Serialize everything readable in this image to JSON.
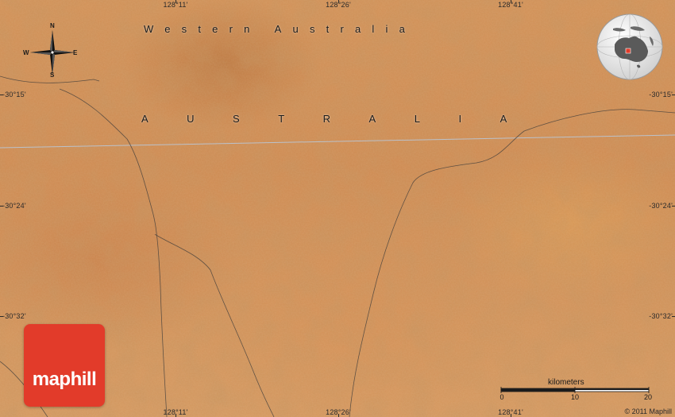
{
  "map": {
    "region_label": "Western Australia",
    "country_label": "AUSTRALIA",
    "coordinates": {
      "longitudes": [
        "128°11'",
        "128°26'",
        "128°41'"
      ],
      "latitudes": [
        "-30°15'",
        "-30°24'",
        "-30°32'"
      ]
    },
    "compass": {
      "north": "N",
      "south": "S",
      "east": "E",
      "west": "W"
    },
    "scale": {
      "unit_label": "kilometers",
      "values": [
        "0",
        "10",
        "20"
      ]
    },
    "logo_text": "maphill",
    "copyright": "© 2011 Maphill",
    "icons": [
      "compass-rose-icon",
      "locator-globe-icon"
    ],
    "colors": {
      "terrain": "#d2935a",
      "logo": "#e23b2a",
      "globe_ocean": "#e8e8e8",
      "globe_marker": "#e23b2a"
    }
  }
}
